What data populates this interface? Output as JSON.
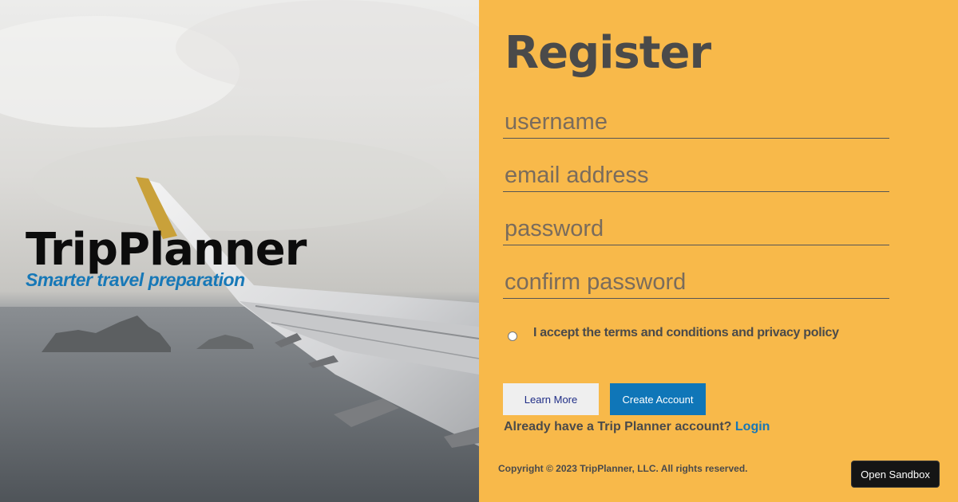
{
  "hero": {
    "brand_title": "TripPlanner",
    "brand_tagline": "Smarter travel preparation"
  },
  "form": {
    "title": "Register",
    "fields": {
      "username_placeholder": "username",
      "email_placeholder": "email address",
      "password_placeholder": "password",
      "confirm_password_placeholder": "confirm password"
    },
    "terms_label": "I accept the terms and conditions and privacy policy",
    "learn_more_label": "Learn More",
    "create_account_label": "Create Account",
    "login_prompt": "Already have a Trip Planner account?",
    "login_link": "Login",
    "copyright": "Copyright © 2023 TripPlanner, LLC. All rights reserved."
  },
  "sandbox_button": "Open Sandbox",
  "colors": {
    "panel_background": "#f8b94a",
    "primary_button": "#0f76b8",
    "secondary_button": "#efefef",
    "tagline": "#1778b7",
    "text_dark": "#4a4a4a"
  },
  "icons": {
    "hero_image": "airplane-wing-over-sea-image"
  }
}
